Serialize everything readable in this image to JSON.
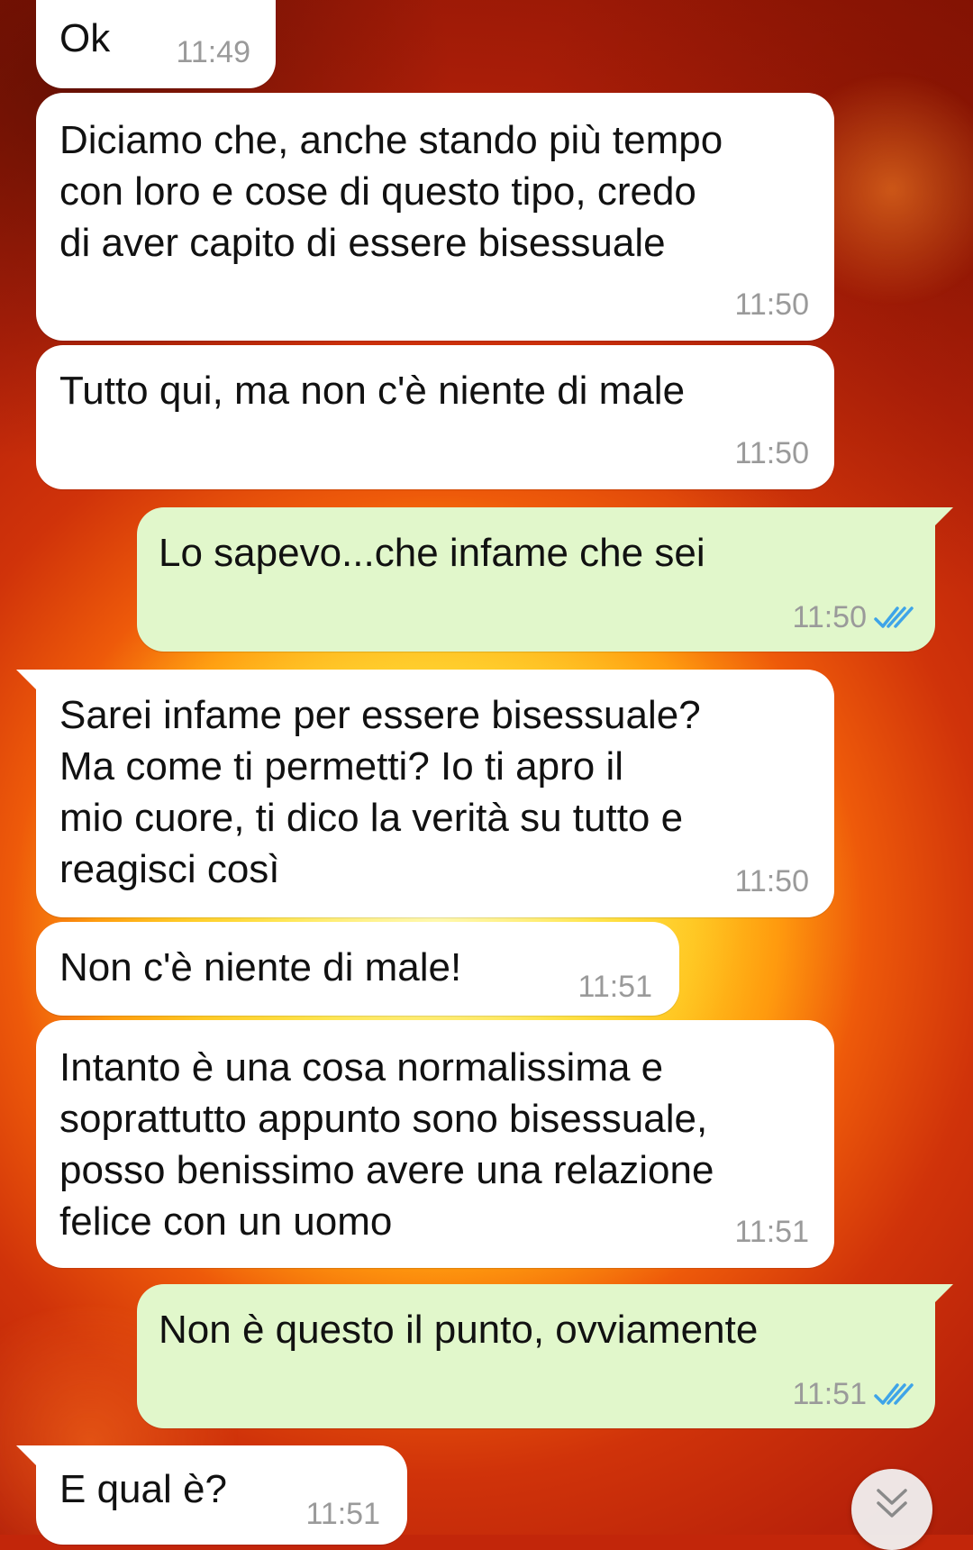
{
  "chat": {
    "messages": [
      {
        "text": "Ok",
        "time": "11:49",
        "direction": "in"
      },
      {
        "text": "Diciamo che, anche stando più tempo\ncon loro e cose di questo tipo, credo\ndi aver capito di essere bisessuale",
        "time": "11:50",
        "direction": "in"
      },
      {
        "text": "Tutto qui, ma non c'è niente di male",
        "time": "11:50",
        "direction": "in"
      },
      {
        "text": "Lo sapevo...che infame che sei",
        "time": "11:50",
        "direction": "out",
        "status": "read"
      },
      {
        "text": "Sarei infame per essere bisessuale?\nMa come ti permetti? Io ti apro il\nmio cuore, ti dico la verità su tutto e\nreagisci così",
        "time": "11:50",
        "direction": "in"
      },
      {
        "text": "Non c'è niente di male!",
        "time": "11:51",
        "direction": "in"
      },
      {
        "text": "Intanto è una cosa normalissima e\nsoprattutto appunto sono bisessuale,\nposso benissimo avere una relazione\nfelice con un uomo",
        "time": "11:51",
        "direction": "in"
      },
      {
        "text": "Non è questo il punto, ovviamente",
        "time": "11:51",
        "direction": "out",
        "status": "read"
      },
      {
        "text": "E qual è?",
        "time": "11:51",
        "direction": "in"
      }
    ]
  },
  "colors": {
    "incoming_bubble": "#ffffff",
    "outgoing_bubble": "#e1f7cb",
    "read_tick": "#3ea4e8",
    "timestamp": "#9a9a9a"
  },
  "icons": {
    "read_status": "double-check-icon",
    "scroll_down": "double-chevron-down-icon"
  }
}
